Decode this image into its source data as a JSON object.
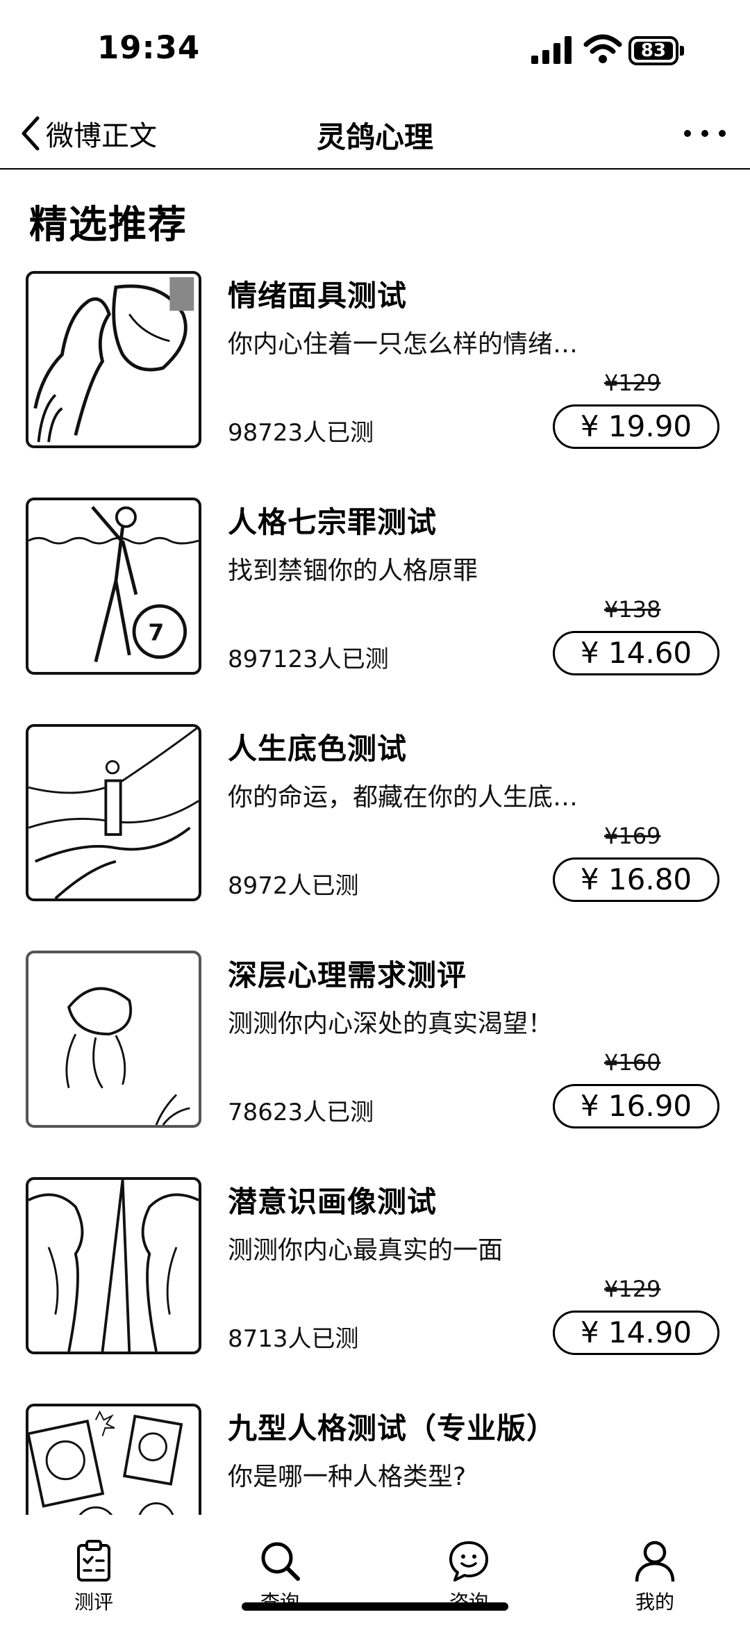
{
  "status_bar": {
    "time": "19:34",
    "battery": "83"
  },
  "nav": {
    "back_label": "微博正文",
    "title": "灵鸽心理"
  },
  "section": {
    "title": "精选推荐"
  },
  "items": [
    {
      "title": "情绪面具测试",
      "desc": "你内心住着一只怎么样的情绪…",
      "count": "98723人已测",
      "old_price": "¥129",
      "price": "¥ 19.90"
    },
    {
      "title": "人格七宗罪测试",
      "desc": "找到禁锢你的人格原罪",
      "count": "897123人已测",
      "old_price": "¥138",
      "price": "¥ 14.60"
    },
    {
      "title": "人生底色测试",
      "desc": "你的命运，都藏在你的人生底…",
      "count": "8972人已测",
      "old_price": "¥169",
      "price": "¥ 16.80"
    },
    {
      "title": "深层心理需求测评",
      "desc": "测测你内心深处的真实渴望！",
      "count": "78623人已测",
      "old_price": "¥160",
      "price": "¥ 16.90"
    },
    {
      "title": "潜意识画像测试",
      "desc": "测测你内心最真实的一面",
      "count": "8713人已测",
      "old_price": "¥129",
      "price": "¥ 14.90"
    },
    {
      "title": "九型人格测试（专业版）",
      "desc": "你是哪一种人格类型?"
    }
  ],
  "tabs": [
    {
      "label": "测评",
      "icon": "clipboard-icon"
    },
    {
      "label": "查询",
      "icon": "search-icon"
    },
    {
      "label": "咨询",
      "icon": "chat-icon"
    },
    {
      "label": "我的",
      "icon": "profile-icon"
    }
  ]
}
